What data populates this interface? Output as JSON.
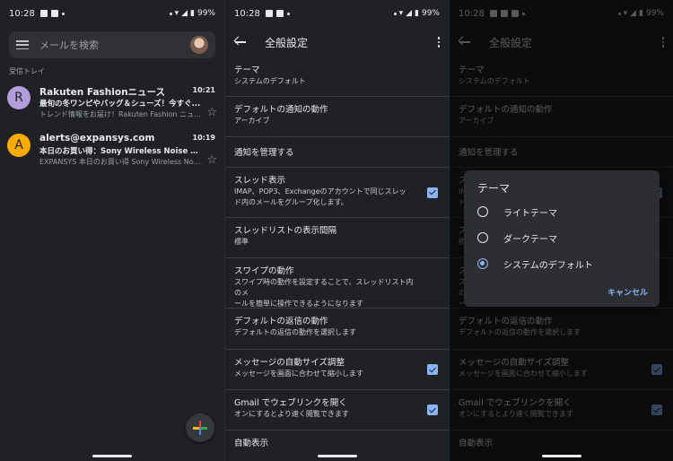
{
  "status": {
    "time": "10:28",
    "battery": "99%"
  },
  "inbox": {
    "search_placeholder": "メールを検索",
    "section_label": "受信トレイ",
    "mails": [
      {
        "avatar_letter": "R",
        "avatar_color": "#b39ddb",
        "from": "Rakuten Fashionニュース",
        "time": "10:21",
        "subject": "最旬の冬ワンピやバッグ＆シューズ！今すぐ...",
        "snippet": "トレンド情報をお届け！Rakuten Fashion ニュ..."
      },
      {
        "avatar_letter": "A",
        "avatar_color": "#f9ab00",
        "from": "alerts@expansys.com",
        "time": "10:19",
        "subject": "本日のお買い得：Sony Wireless Noise Cance...",
        "snippet": "EXPANSYS 本日のお買い得 Sony Wireless Noi..."
      }
    ]
  },
  "settings": {
    "title": "全般設定",
    "items": [
      {
        "title": "テーマ",
        "sub": "システムのデフォルト"
      },
      {
        "title": "デフォルトの通知の動作",
        "sub": "アーカイブ"
      },
      {
        "title": "通知を管理する",
        "sub": ""
      },
      {
        "title": "スレッド表示",
        "sub1": "IMAP、POP3、Exchangeのアカウントで同じスレッ",
        "sub2": "ド内のメールをグループ化します。",
        "checked": true
      },
      {
        "title": "スレッドリストの表示間隔",
        "sub": "標準"
      },
      {
        "title": "スワイプの動作",
        "sub1": "スワイプ時の動作を設定することで、スレッドリスト内のメ",
        "sub2": "ールを簡単に操作できるようになります"
      },
      {
        "title": "デフォルトの返信の動作",
        "sub": "デフォルトの返信の動作を選択します"
      },
      {
        "title": "メッセージの自動サイズ調整",
        "sub": "メッセージを画面に合わせて縮小します",
        "checked": true
      },
      {
        "title": "Gmail でウェブリンクを開く",
        "sub": "オンにするとより速く閲覧できます",
        "checked": true
      },
      {
        "title": "自動表示",
        "sub": ""
      }
    ]
  },
  "dialog": {
    "title": "テーマ",
    "options": [
      "ライトテーマ",
      "ダークテーマ",
      "システムのデフォルト"
    ],
    "selected_index": 2,
    "cancel": "キャンセル"
  },
  "colors": {
    "background": "#202124",
    "accent": "#8ab4f8"
  }
}
